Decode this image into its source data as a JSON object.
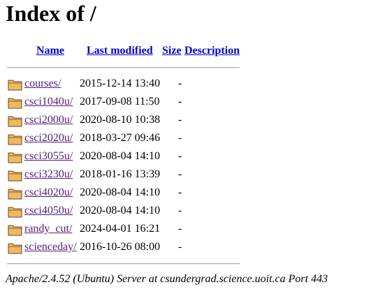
{
  "page": {
    "title": "Index of /"
  },
  "columns": {
    "name": "Name",
    "last_modified": "Last modified",
    "size": "Size",
    "description": "Description"
  },
  "entries": [
    {
      "name": "courses/",
      "modified": "2015-12-14 13:40",
      "size": "-",
      "icon": "folder-icon"
    },
    {
      "name": "csci1040u/",
      "modified": "2017-09-08 11:50",
      "size": "-",
      "icon": "folder-icon"
    },
    {
      "name": "csci2000u/",
      "modified": "2020-08-10 10:38",
      "size": "-",
      "icon": "folder-icon"
    },
    {
      "name": "csci2020u/",
      "modified": "2018-03-27 09:46",
      "size": "-",
      "icon": "folder-icon"
    },
    {
      "name": "csci3055u/",
      "modified": "2020-08-04 14:10",
      "size": "-",
      "icon": "folder-icon"
    },
    {
      "name": "csci3230u/",
      "modified": "2018-01-16 13:39",
      "size": "-",
      "icon": "folder-icon"
    },
    {
      "name": "csci4020u/",
      "modified": "2020-08-04 14:10",
      "size": "-",
      "icon": "folder-icon"
    },
    {
      "name": "csci4050u/",
      "modified": "2020-08-04 14:10",
      "size": "-",
      "icon": "folder-icon"
    },
    {
      "name": "randy_cut/",
      "modified": "2024-04-01 16:21",
      "size": "-",
      "icon": "folder-icon"
    },
    {
      "name": "scienceday/",
      "modified": "2016-10-26 08:00",
      "size": "-",
      "icon": "folder-icon"
    }
  ],
  "footer": {
    "server_signature": "Apache/2.4.52 (Ubuntu) Server at csundergrad.science.uoit.ca Port 443"
  },
  "colors": {
    "link": "#0000ee",
    "visited_link": "#551a8b",
    "folder_fill": "#f0b860",
    "folder_outline": "#6b4a1a",
    "rule": "#a8a8a8"
  }
}
